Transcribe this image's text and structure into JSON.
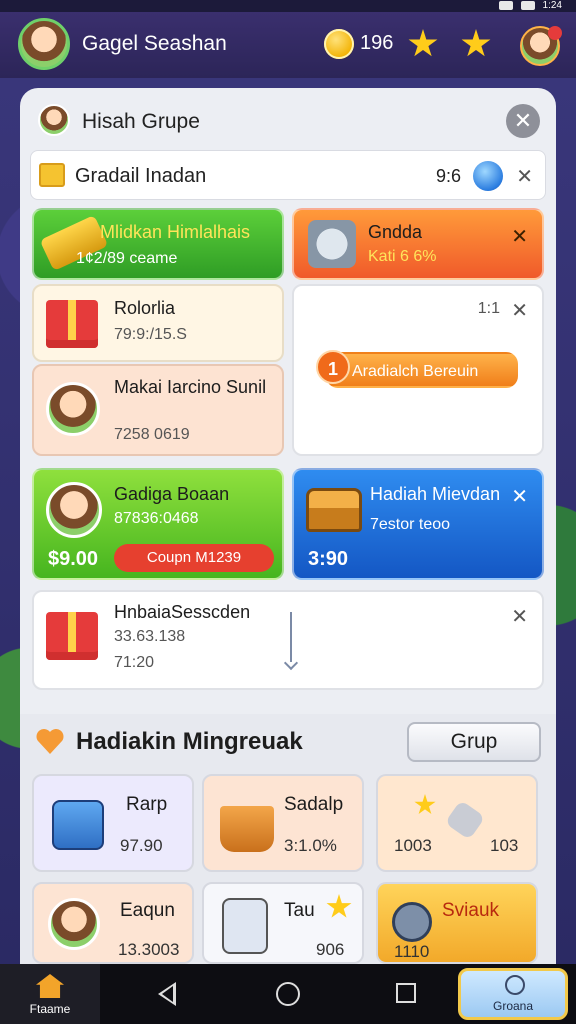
{
  "status": {
    "time": "1:24"
  },
  "topbar": {
    "player_name": "Gagel Seashan",
    "coins": "196"
  },
  "panel": {
    "title": "Hisah Grupe",
    "close_label": "✕",
    "search": {
      "text": "Gradail Inadan",
      "count": "9:6",
      "close": "✕"
    }
  },
  "cards": {
    "card1": {
      "title": "Mlidkan Himlalhais",
      "sub": "1¢2/89 ceame"
    },
    "card2": {
      "title": "Gndda",
      "sub": "Kati 6 6%",
      "close": "✕"
    },
    "card3": {
      "title": "Rolorlia",
      "sub": "79:9:/15.S"
    },
    "card4": {
      "title": "Makai Iarcino Sunil",
      "sub": "7258 0619"
    },
    "card5": {
      "time": "1:1",
      "close": "✕",
      "event_badge": "1",
      "event_button": "Aradialch Bereuin"
    },
    "card6": {
      "title": "Gadiga Boaan",
      "sub": "87836:0468",
      "price": "$9.00",
      "coupon": "Coupn",
      "coupon_code": "M1239"
    },
    "card7": {
      "title": "Hadiah Mievdan",
      "sub": "7estor teoo",
      "price": "3:90",
      "close": "✕"
    },
    "card8": {
      "title": "HnbaiaSesscden",
      "sub": "33.63.138",
      "time": "71:20",
      "close": "✕"
    }
  },
  "section": {
    "title": "Hadiakin Mingreuak",
    "grup_button": "Grup",
    "tiles": [
      {
        "name": "Rarp",
        "value": "97.90"
      },
      {
        "name": "Sadalp",
        "value": "3:1.0%"
      },
      {
        "name": "",
        "value": "1003",
        "value2": "103"
      },
      {
        "name": "Eaqun",
        "value": "13.3003"
      },
      {
        "name": "Tau",
        "value": "906"
      },
      {
        "name": "Sviauk",
        "value": "1110"
      }
    ]
  },
  "navbar": {
    "home_label": "Ftaame",
    "group_label": "Groana"
  },
  "colors": {
    "accent_green": "#46b51f",
    "accent_orange": "#f07f1a",
    "accent_blue": "#1457c4",
    "coin_gold": "#f2b100"
  }
}
